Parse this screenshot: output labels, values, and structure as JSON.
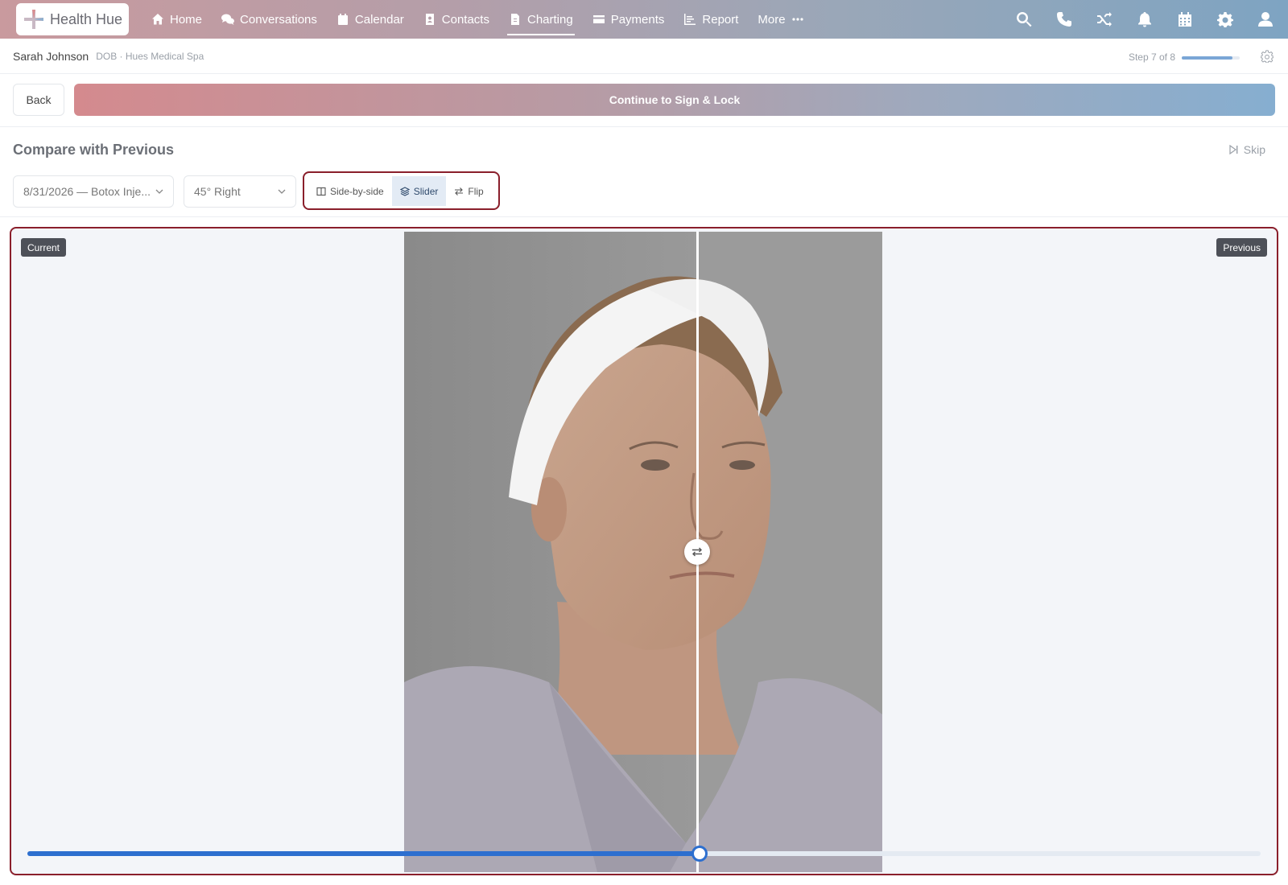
{
  "app": {
    "name": "Health Hue"
  },
  "nav": {
    "items": [
      {
        "label": "Home",
        "icon": "home-icon"
      },
      {
        "label": "Conversations",
        "icon": "chat-icon"
      },
      {
        "label": "Calendar",
        "icon": "calendar-icon"
      },
      {
        "label": "Contacts",
        "icon": "contact-card-icon"
      },
      {
        "label": "Charting",
        "icon": "document-icon",
        "active": true
      },
      {
        "label": "Payments",
        "icon": "credit-card-icon"
      },
      {
        "label": "Report",
        "icon": "chart-icon"
      },
      {
        "label": "More",
        "icon": "ellipsis-icon"
      }
    ],
    "right_icons": [
      "search-icon",
      "phone-icon",
      "shuffle-icon",
      "bell-icon",
      "calendar-icon",
      "gear-icon",
      "user-icon"
    ]
  },
  "patient": {
    "name": "Sarah Johnson",
    "subtitle": "DOB · Hues Medical Spa",
    "step_label": "Step 7 of 8",
    "step_progress": 0.875
  },
  "actions": {
    "back_label": "Back",
    "continue_label": "Continue to Sign & Lock"
  },
  "compare": {
    "title": "Compare with Previous",
    "skip_label": "Skip",
    "visit_select": "8/31/2026 — Botox Inje...",
    "angle_select": "45° Right",
    "modes": [
      {
        "label": "Side-by-side",
        "icon": "columns-icon"
      },
      {
        "label": "Slider",
        "icon": "layers-icon",
        "active": true
      },
      {
        "label": "Flip",
        "icon": "swap-icon"
      }
    ]
  },
  "viewer": {
    "current_label": "Current",
    "previous_label": "Previous",
    "slider_value": 0.545
  },
  "colors": {
    "accent": "#2d6fcf",
    "highlight_border": "#8a1f2b",
    "nav_gradient_start": "#c99a9e",
    "nav_gradient_end": "#7ea4c2"
  }
}
